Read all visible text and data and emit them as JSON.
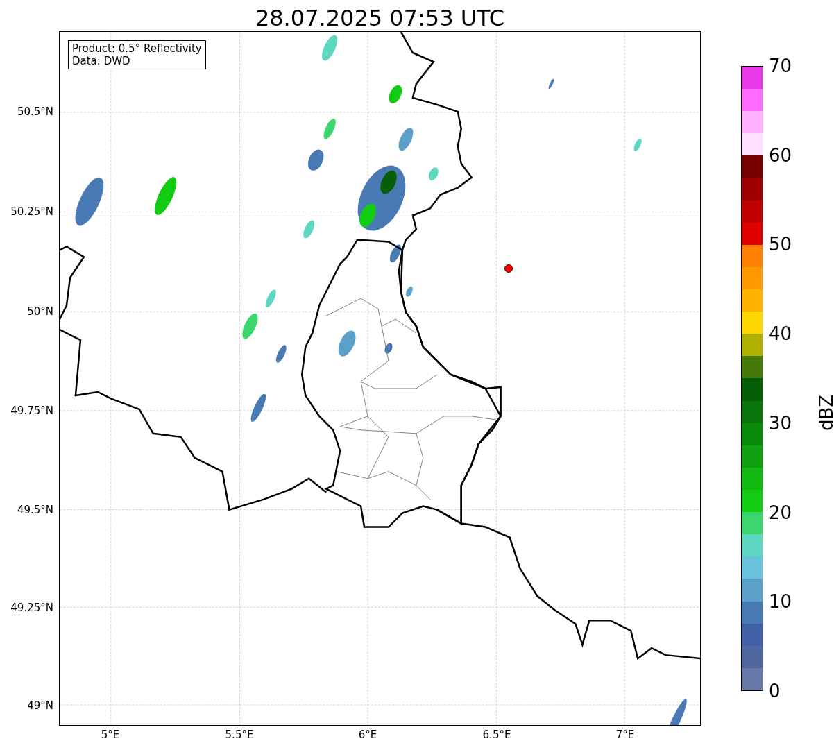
{
  "title": "28.07.2025 07:53 UTC",
  "map": {
    "legend": [
      "Product: 0.5° Reflectivity",
      "Data: DWD"
    ],
    "lat_ticks": [
      "50.5°N",
      "50.25°N",
      "50°N",
      "49.75°N",
      "49.5°N",
      "49.25°N",
      "49°N"
    ],
    "lon_ticks": [
      "5°E",
      "5.5°E",
      "6°E",
      "6.5°E",
      "7°E"
    ],
    "marker": {
      "color": "#ff0000"
    }
  },
  "colorbar": {
    "label": "dBZ",
    "ticks": [
      "70",
      "60",
      "50",
      "40",
      "30",
      "20",
      "10",
      "0"
    ],
    "segments": [
      {
        "color": "#6878a8"
      },
      {
        "color": "#5068a0"
      },
      {
        "color": "#4361a8"
      },
      {
        "color": "#4a7ab4"
      },
      {
        "color": "#5ba0c8"
      },
      {
        "color": "#68c2dc"
      },
      {
        "color": "#5dd6c2"
      },
      {
        "color": "#3cd66e"
      },
      {
        "color": "#12cc12"
      },
      {
        "color": "#10b810"
      },
      {
        "color": "#0fa00f"
      },
      {
        "color": "#0a8a0a"
      },
      {
        "color": "#0a750a"
      },
      {
        "color": "#065e06"
      },
      {
        "color": "#457a0a"
      },
      {
        "color": "#b0b000"
      },
      {
        "color": "#ffd700"
      },
      {
        "color": "#ffb300"
      },
      {
        "color": "#ff9900"
      },
      {
        "color": "#ff7f00"
      },
      {
        "color": "#e00000"
      },
      {
        "color": "#c00000"
      },
      {
        "color": "#a00000"
      },
      {
        "color": "#7a0000"
      },
      {
        "color": "#ffe0ff"
      },
      {
        "color": "#ffb0ff"
      },
      {
        "color": "#ff6aff"
      },
      {
        "color": "#e83ae8"
      }
    ]
  }
}
